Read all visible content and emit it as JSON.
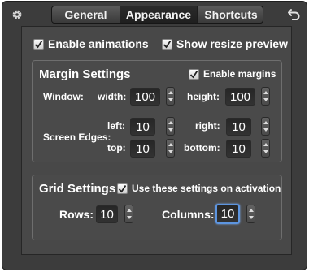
{
  "tabs": [
    {
      "label": "General",
      "active": false
    },
    {
      "label": "Appearance",
      "active": true
    },
    {
      "label": "Shortcuts",
      "active": false
    }
  ],
  "options": {
    "enable_animations": {
      "label": "Enable animations",
      "checked": true
    },
    "show_resize_preview": {
      "label": "Show resize preview",
      "checked": true
    }
  },
  "margin": {
    "title": "Margin Settings",
    "enable_margins": {
      "label": "Enable margins",
      "checked": true
    },
    "window_label": "Window:",
    "width_label": "width:",
    "width_value": "100",
    "height_label": "height:",
    "height_value": "100",
    "screen_edges_label": "Screen Edges:",
    "left_label": "left:",
    "left_value": "10",
    "right_label": "right:",
    "right_value": "10",
    "top_label": "top:",
    "top_value": "10",
    "bottom_label": "bottom:",
    "bottom_value": "10"
  },
  "grid": {
    "title": "Grid Settings",
    "use_on_activation": {
      "label": "Use these settings on activation",
      "checked": true
    },
    "rows_label": "Rows:",
    "rows_value": "10",
    "columns_label": "Columns:",
    "columns_value": "10"
  },
  "icons": {
    "gear": "gear-icon",
    "back": "back-arrow-icon"
  },
  "colors": {
    "focus_ring": "#5d95e0",
    "window_bg": "#3c3c3c"
  }
}
